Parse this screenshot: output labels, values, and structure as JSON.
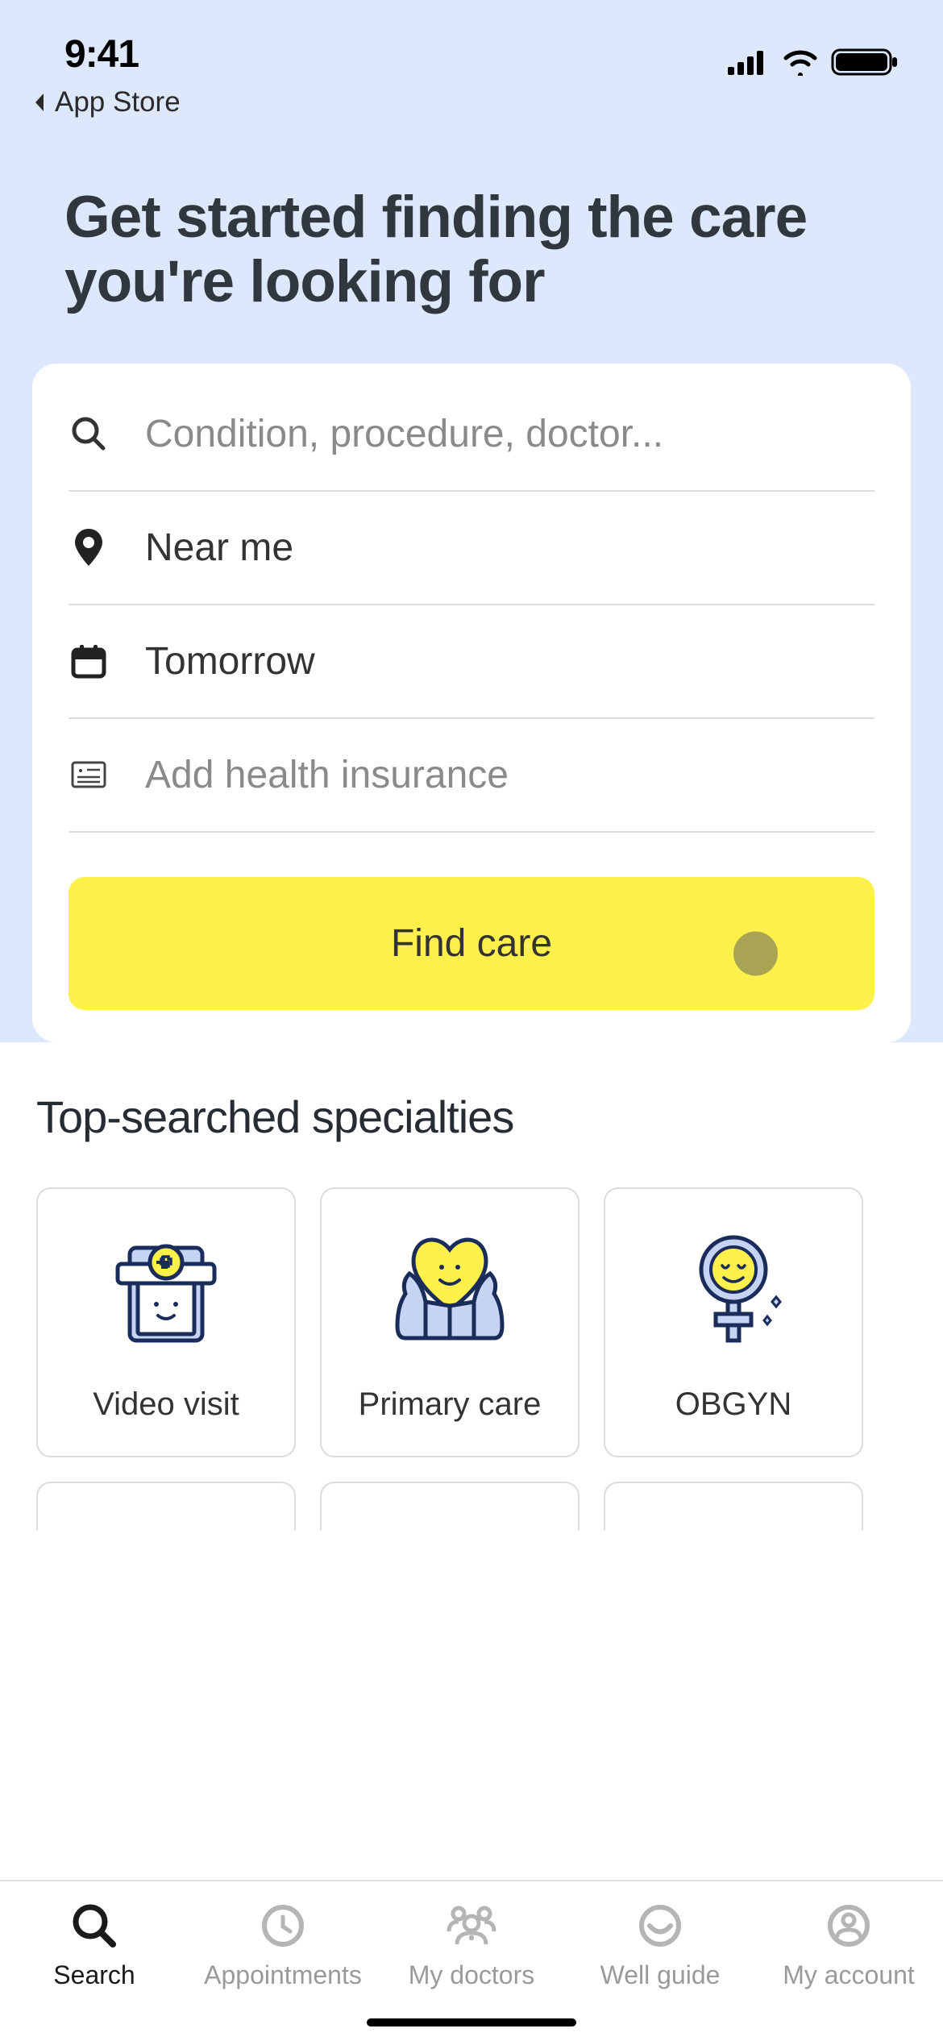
{
  "status": {
    "time": "9:41",
    "back_label": "App Store"
  },
  "hero": {
    "title": "Get started finding the care you're looking for"
  },
  "search": {
    "condition_placeholder": "Condition, procedure, doctor...",
    "location_label": "Near me",
    "date_label": "Tomorrow",
    "insurance_placeholder": "Add health insurance",
    "button_label": "Find care"
  },
  "specialties": {
    "title": "Top-searched specialties",
    "cards": [
      {
        "label": "Video visit"
      },
      {
        "label": "Primary care"
      },
      {
        "label": "OBGYN"
      }
    ]
  },
  "tabs": {
    "search": "Search",
    "appointments": "Appointments",
    "my_doctors": "My doctors",
    "well_guide": "Well guide",
    "my_account": "My account"
  }
}
